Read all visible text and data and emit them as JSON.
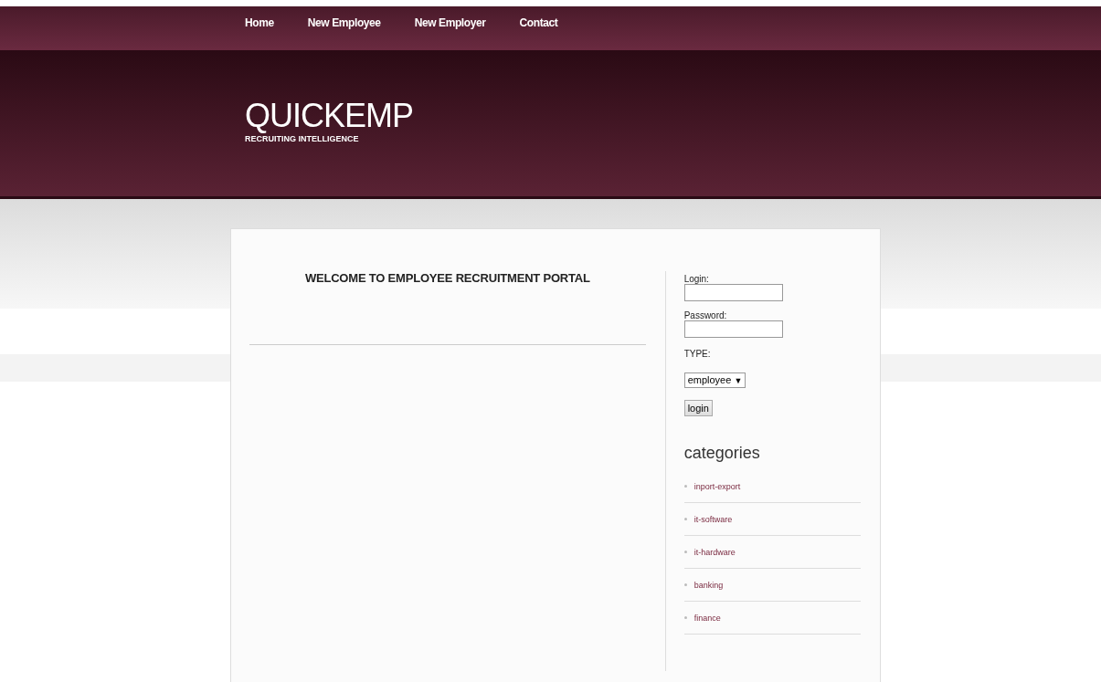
{
  "nav": [
    {
      "label": "Home"
    },
    {
      "label": "New Employee"
    },
    {
      "label": "New Employer"
    },
    {
      "label": "Contact"
    }
  ],
  "header": {
    "title": "QUICKEMP",
    "tagline": "RECRUITING INTELLIGENCE"
  },
  "main": {
    "heading": "WELCOME TO EMPLOYEE RECRUITMENT PORTAL"
  },
  "login_form": {
    "login_label": "Login:",
    "password_label": "Password:",
    "type_label": "TYPE:",
    "type_value": "employee",
    "type_arrow": "▼",
    "submit": "login"
  },
  "categories": {
    "title": "categories",
    "items": [
      {
        "label": "inport-export"
      },
      {
        "label": "it-software"
      },
      {
        "label": "it-hardware"
      },
      {
        "label": "banking"
      },
      {
        "label": "finance"
      }
    ]
  }
}
